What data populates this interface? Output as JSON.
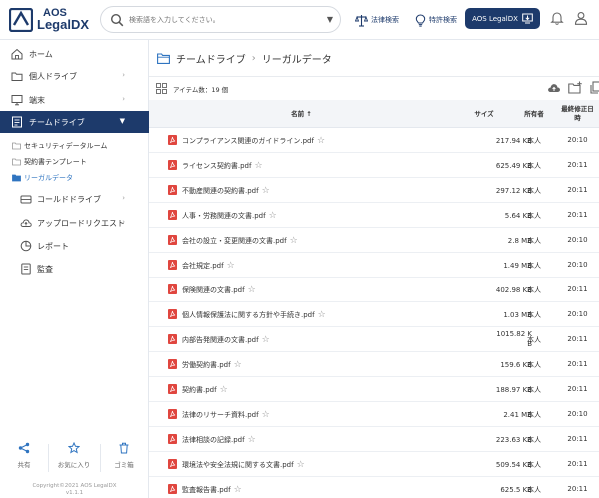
{
  "header": {
    "logo_top": "AOS",
    "logo_bottom": "LegalDX",
    "search_placeholder": "検索語を入力してください。",
    "law_search": "法律検索",
    "patent_search": "特許検索",
    "account_button": "AOS LegalDX"
  },
  "sidebar": {
    "items": [
      {
        "label": "ホーム",
        "icon": "home-icon"
      },
      {
        "label": "個人ドライブ",
        "icon": "drive-icon"
      },
      {
        "label": "端末",
        "icon": "monitor-icon"
      },
      {
        "label": "チームドライブ",
        "icon": "team-drive-icon"
      },
      {
        "label": "コールドドライブ",
        "icon": "cold-drive-icon"
      },
      {
        "label": "アップロードリクエスト",
        "icon": "upload-request-icon"
      },
      {
        "label": "レポート",
        "icon": "report-icon"
      },
      {
        "label": "監査",
        "icon": "audit-icon"
      }
    ],
    "team_children": [
      {
        "label": "セキュリティデータルーム"
      },
      {
        "label": "契約書テンプレート"
      },
      {
        "label": "リーガルデータ"
      }
    ],
    "share_label": "共有",
    "favorites_label": "お気に入り",
    "trash_label": "ゴミ箱",
    "copyright_line1": "Copyright©2021 AOS LegalDX",
    "copyright_line2": "v1.1.1"
  },
  "main": {
    "breadcrumb_root": "チームドライブ",
    "breadcrumb_sep": "›",
    "breadcrumb_current": "リーガルデータ",
    "item_count": "アイテム数：19 個",
    "columns": {
      "name": "名前 ↑",
      "size": "サイズ",
      "owner": "所有者",
      "modified_line1": "最終修正日",
      "modified_line2": "時"
    },
    "files": [
      {
        "name": "コンプライアンス関連のガイドライン.pdf",
        "size": "217.94 KB",
        "owner": "本人",
        "time": "20:10"
      },
      {
        "name": "ライセンス契約書.pdf",
        "size": "625.49 KB",
        "owner": "本人",
        "time": "20:11"
      },
      {
        "name": "不動産関連の契約書.pdf",
        "size": "297.12 KB",
        "owner": "本人",
        "time": "20:11"
      },
      {
        "name": "人事・労務関連の文書.pdf",
        "size": "5.64 KB",
        "owner": "本人",
        "time": "20:11"
      },
      {
        "name": "会社の設立・変更関連の文書.pdf",
        "size": "2.8 MB",
        "owner": "本人",
        "time": "20:10"
      },
      {
        "name": "会社規定.pdf",
        "size": "1.49 MB",
        "owner": "本人",
        "time": "20:10"
      },
      {
        "name": "保険関連の文書.pdf",
        "size": "402.98 KB",
        "owner": "本人",
        "time": "20:11"
      },
      {
        "name": "個人情報保護法に関する方針や手続き.pdf",
        "size": "1.03 MB",
        "owner": "本人",
        "time": "20:10"
      },
      {
        "name": "内部告発関連の文書.pdf",
        "size_line1": "1015.82 K",
        "size_line2": "B",
        "owner": "本人",
        "time": "20:11"
      },
      {
        "name": "労働契約書.pdf",
        "size": "159.6 KB",
        "owner": "本人",
        "time": "20:11"
      },
      {
        "name": "契約書.pdf",
        "size": "188.97 KB",
        "owner": "本人",
        "time": "20:11"
      },
      {
        "name": "法律のリサーチ資料.pdf",
        "size": "2.41 MB",
        "owner": "本人",
        "time": "20:10"
      },
      {
        "name": "法律相談の記録.pdf",
        "size": "223.63 KB",
        "owner": "本人",
        "time": "20:11"
      },
      {
        "name": "環境法や安全法規に関する文書.pdf",
        "size": "509.54 KB",
        "owner": "本人",
        "time": "20:11"
      },
      {
        "name": "監査報告書.pdf",
        "size": "625.5 KB",
        "owner": "本人",
        "time": "20:11"
      }
    ]
  },
  "colors": {
    "brand": "#1d3a6b",
    "pdf": "#e0463f",
    "link": "#2f74c0"
  }
}
